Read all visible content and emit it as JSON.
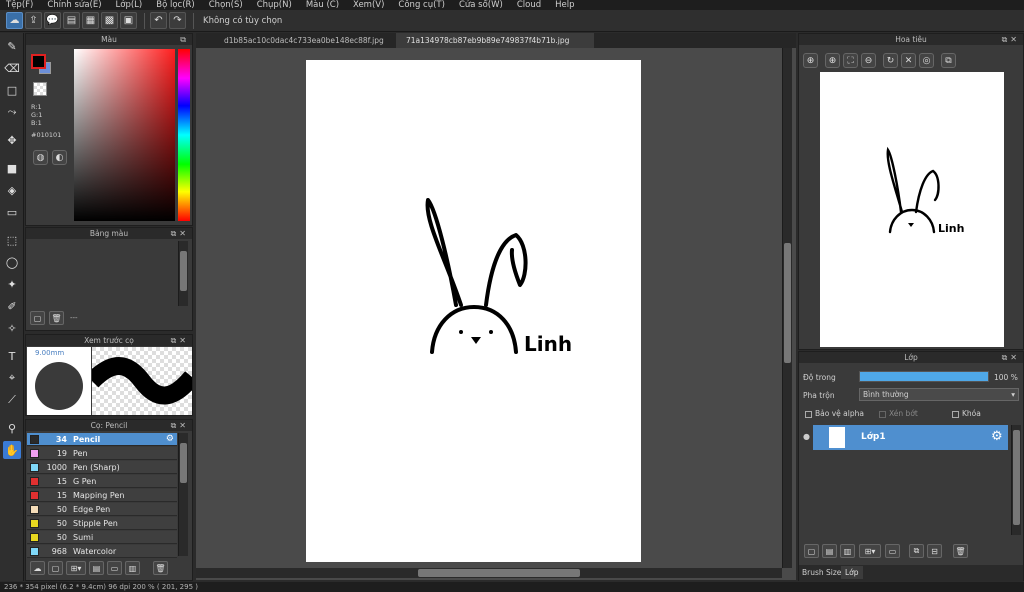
{
  "menu": [
    "Tệp(F)",
    "Chỉnh sửa(E)",
    "Lớp(L)",
    "Bộ lọc(R)",
    "Chọn(S)",
    "Chụp(N)",
    "Màu (C)",
    "Xem(V)",
    "Công cụ(T)",
    "Cửa sổ(W)",
    "Cloud",
    "Help"
  ],
  "toolbar": {
    "selection_status": "Không có tùy chọn"
  },
  "color_panel": {
    "title": "Màu",
    "r": "R:1",
    "g": "G:1",
    "b": "B:1",
    "hex": "#010101",
    "fg_color": "#010101",
    "bg_color": "#6c8fd8"
  },
  "palette_panel": {
    "title": "Bảng màu",
    "more": "---"
  },
  "preview_panel": {
    "title": "Xem trước cọ",
    "size": "9.00mm"
  },
  "brush_panel": {
    "title": "Cọ: Pencil",
    "brushes": [
      {
        "size": "34",
        "name": "Pencil",
        "color": "#2a2a2a"
      },
      {
        "size": "19",
        "name": "Pen",
        "color": "#f0a0f0"
      },
      {
        "size": "1000",
        "name": "Pen (Sharp)",
        "color": "#7fd8f8"
      },
      {
        "size": "15",
        "name": "G Pen",
        "color": "#e03030"
      },
      {
        "size": "15",
        "name": "Mapping Pen",
        "color": "#e03030"
      },
      {
        "size": "50",
        "name": "Edge Pen",
        "color": "#f4dcb8"
      },
      {
        "size": "50",
        "name": "Stipple Pen",
        "color": "#e8d820"
      },
      {
        "size": "50",
        "name": "Sumi",
        "color": "#e8d820"
      },
      {
        "size": "968",
        "name": "Watercolor",
        "color": "#7fd8f8"
      }
    ]
  },
  "document_tabs": [
    "d1b85ac10c0dac4c733ea0be148ec88f.jpg",
    "71a134978cb87eb9b89e749837f4b71b.jpg"
  ],
  "active_tab_index": 1,
  "drawing": {
    "signature": "Linh"
  },
  "navigator_panel": {
    "title": "Hoa tiêu"
  },
  "layer_panel": {
    "title": "Lớp",
    "opacity_label": "Độ trong",
    "opacity_value": "100 %",
    "opacity_fraction": 1.0,
    "blend_label": "Pha trộn",
    "blend_value": "Bình thường",
    "protect_alpha": "Bảo vệ alpha",
    "clipping": "Xén bớt",
    "lock": "Khóa",
    "layers": [
      {
        "name": "Lớp1"
      }
    ]
  },
  "bottom_tabs": [
    "Brush Size",
    "Lớp"
  ],
  "status": "236 * 354 pixel   (6.2 * 9.4cm)   96 dpi   200 %   ( 201, 295 )"
}
